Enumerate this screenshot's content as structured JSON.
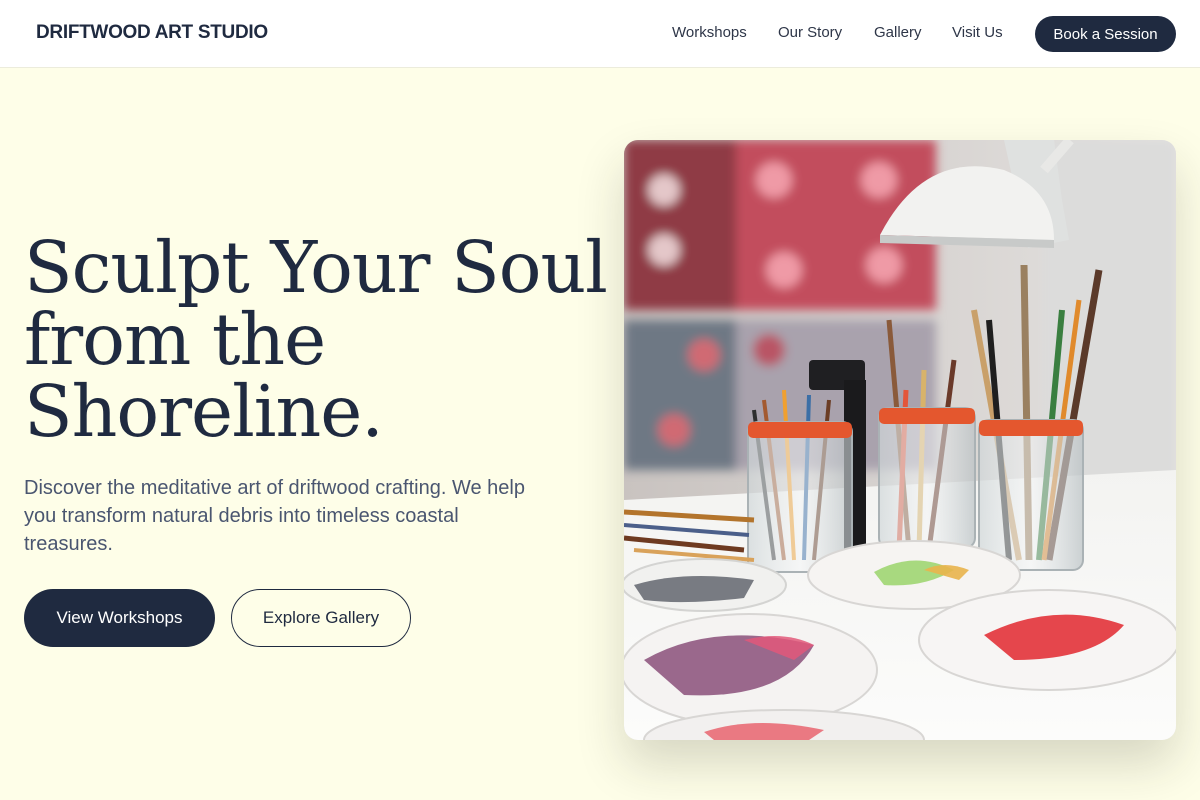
{
  "header": {
    "brand": "DRIFTWOOD ART STUDIO",
    "nav": [
      "Workshops",
      "Our Story",
      "Gallery",
      "Visit Us"
    ],
    "cta": "Book a Session"
  },
  "hero": {
    "headline": [
      "Sculpt Your Soul",
      "from the",
      "Shoreline."
    ],
    "subtext": "Discover the meditative art of driftwood crafting. We help you transform natural debris into timeless coastal treasures.",
    "primary_button": "View Workshops",
    "secondary_button": "Explore Gallery",
    "image": "photo of paintbrushes in glass jars and paint palettes on a studio table"
  },
  "colors": {
    "navy": "#1f2a40",
    "background": "#fefee8",
    "body_text": "#4a5670"
  }
}
